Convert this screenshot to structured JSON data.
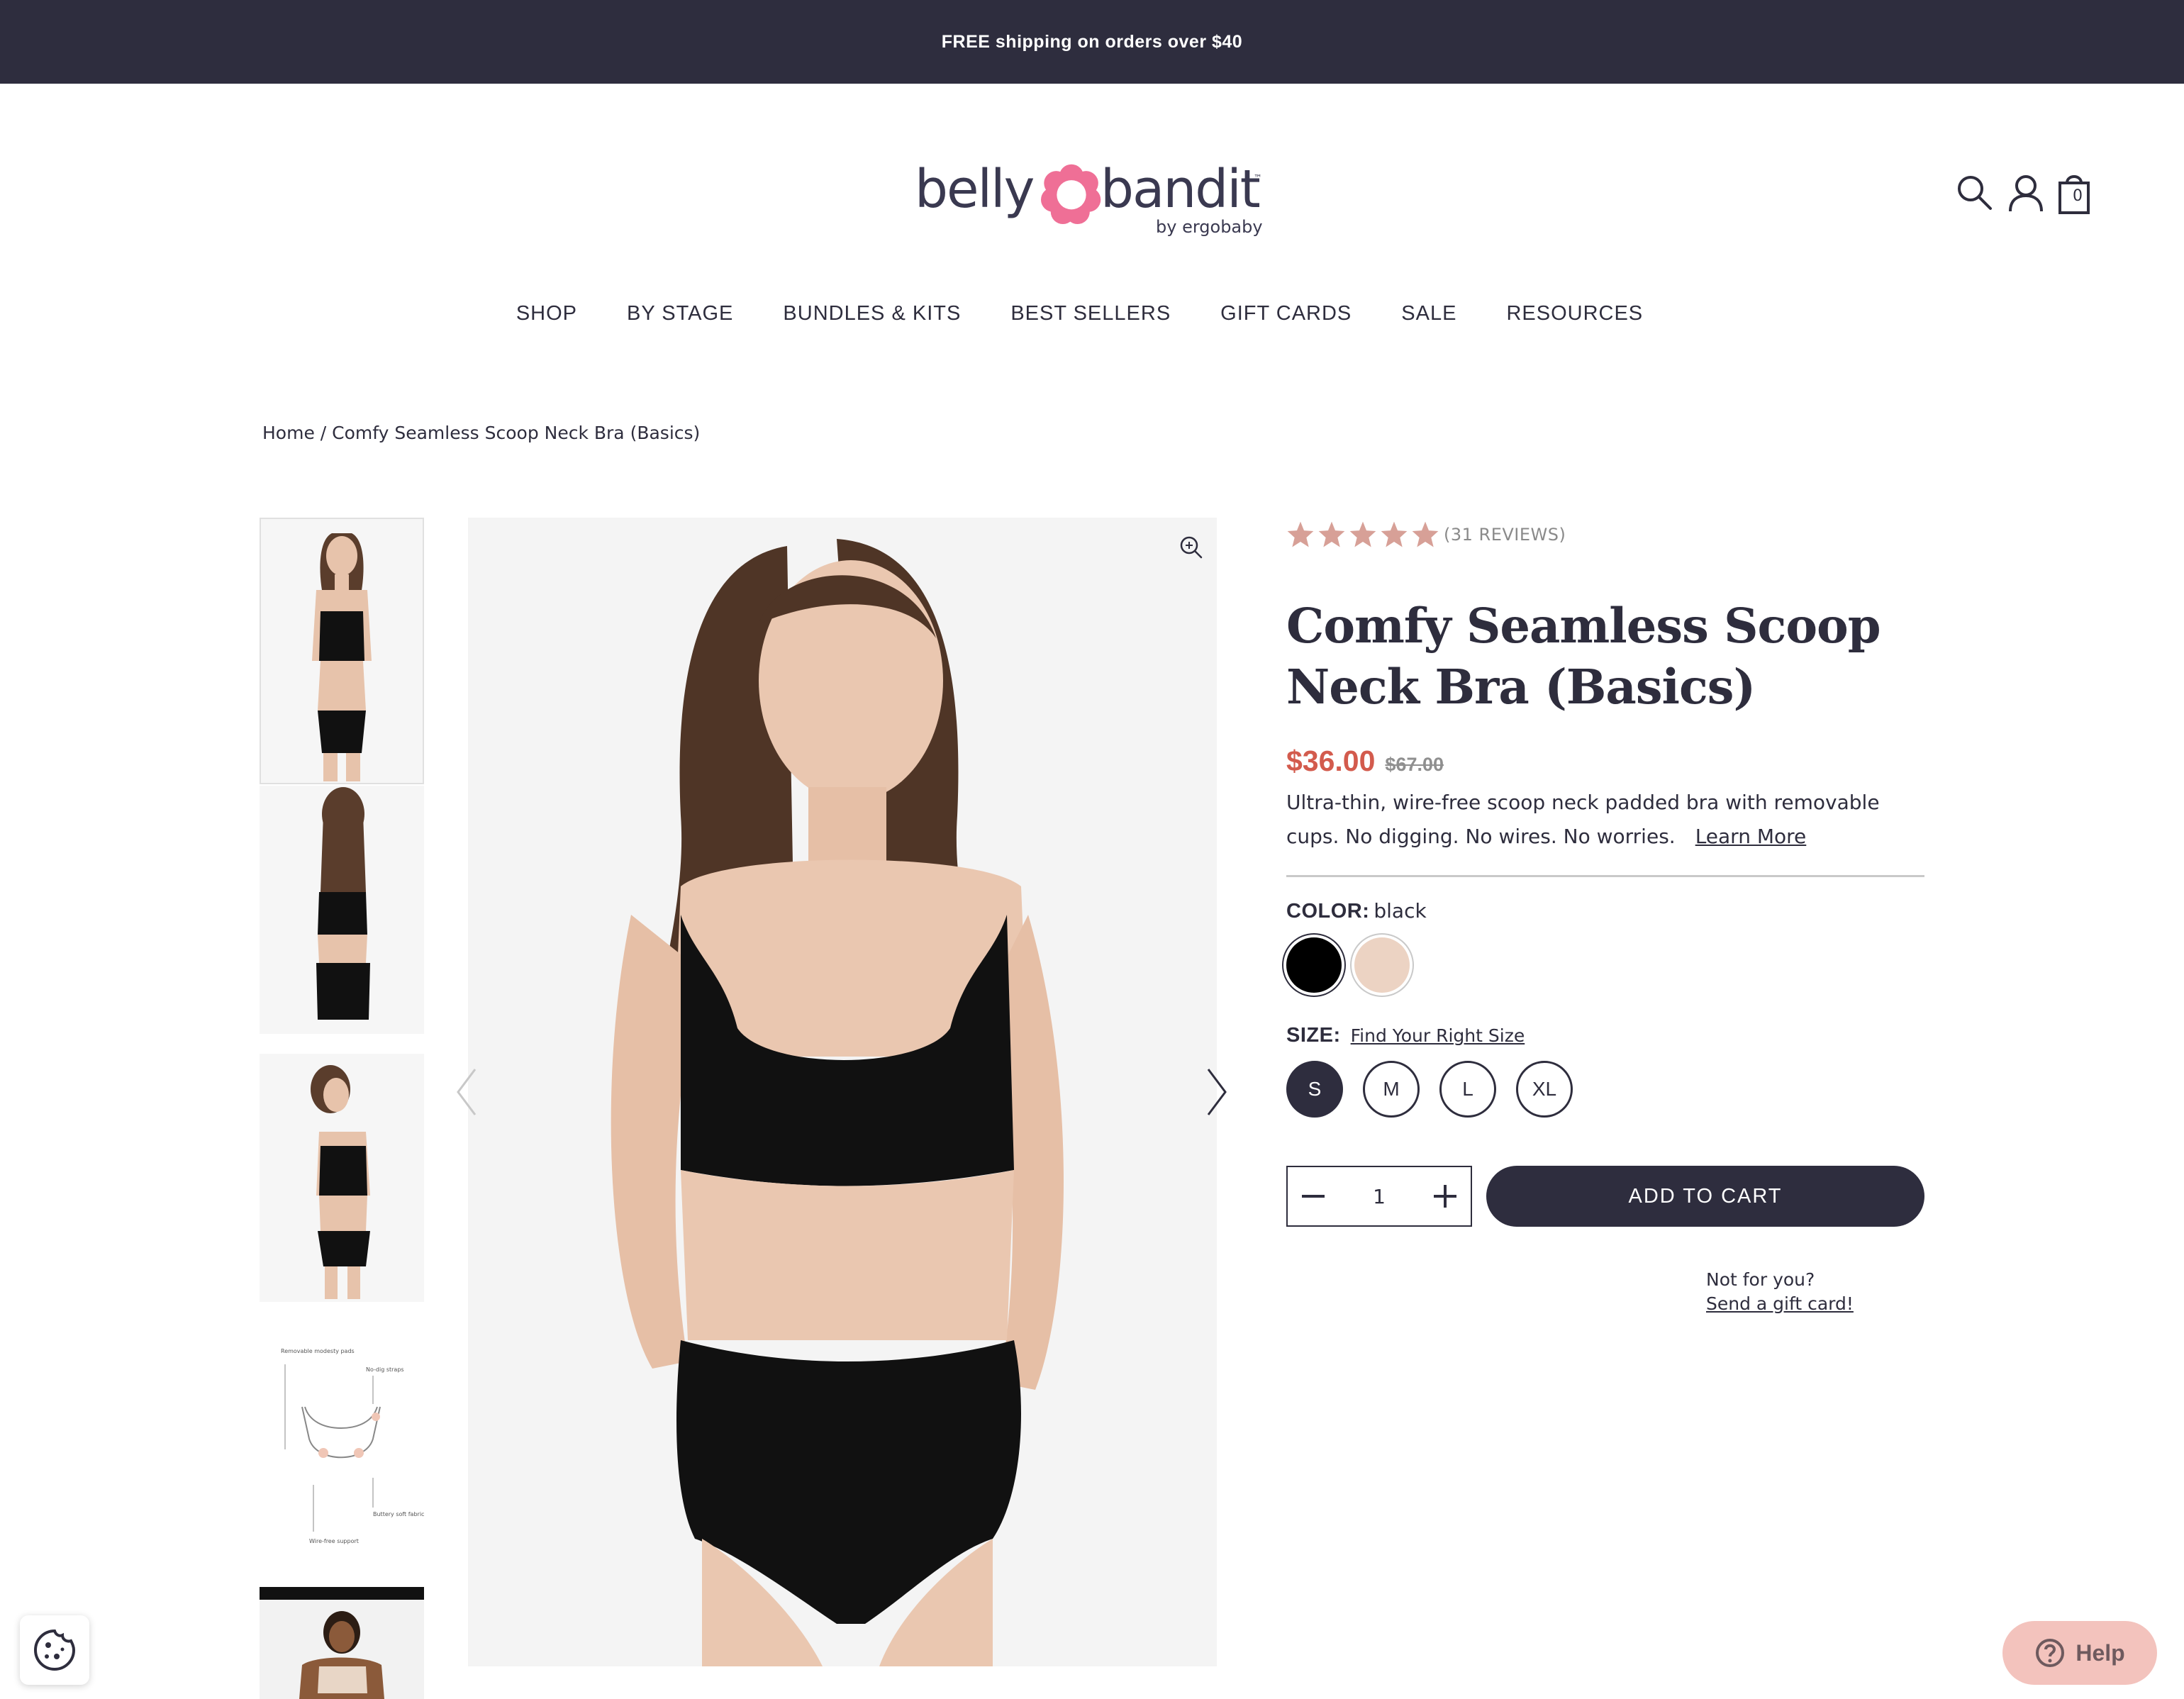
{
  "announcement": {
    "text": "FREE shipping on orders over $40"
  },
  "brand": {
    "word1": "belly",
    "word2": "bandit",
    "tagline": "by ergobaby",
    "trademark": "™",
    "accent_color": "#ef6f96",
    "text_color": "#3a3950"
  },
  "header": {
    "cart_count": "0",
    "icons": [
      "search-icon",
      "account-icon",
      "cart-icon"
    ]
  },
  "nav": {
    "items": [
      "SHOP",
      "BY STAGE",
      "BUNDLES & KITS",
      "BEST SELLERS",
      "GIFT CARDS",
      "SALE",
      "RESOURCES"
    ]
  },
  "breadcrumb": {
    "home": "Home",
    "separator": " / ",
    "current": "Comfy Seamless Scoop Neck Bra (Basics)"
  },
  "gallery": {
    "thumbnail_count": 5,
    "diagram_labels": [
      "Removable modesty pads",
      "No-dig straps",
      "Buttery soft fabric",
      "Wire-free support"
    ]
  },
  "product": {
    "rating": {
      "stars": 5,
      "reviews_label": "(31 REVIEWS)",
      "star_color": "#d7a097"
    },
    "title": "Comfy Seamless Scoop Neck Bra (Basics)",
    "price": "$36.00",
    "compare_price": "$67.00",
    "price_color": "#d35b4d",
    "description": "Ultra-thin, wire-free scoop neck padded bra with removable cups. No digging. No wires. No worries.",
    "learn_more": "Learn More",
    "color_label": "COLOR:",
    "color_value": "black",
    "colors": [
      {
        "name": "black",
        "hex": "#000000"
      },
      {
        "name": "nude",
        "hex": "#ecd3c3"
      }
    ],
    "size_label": "SIZE:",
    "size_guide": "Find Your Right Size",
    "sizes": [
      "S",
      "M",
      "L",
      "XL"
    ],
    "selected_size": "S",
    "quantity": "1",
    "add_to_cart": "ADD TO CART",
    "gift_line1": "Not for you?",
    "gift_line2": "Send a gift card!"
  },
  "widgets": {
    "help_label": "Help",
    "help_color": "#f3c3bd"
  }
}
